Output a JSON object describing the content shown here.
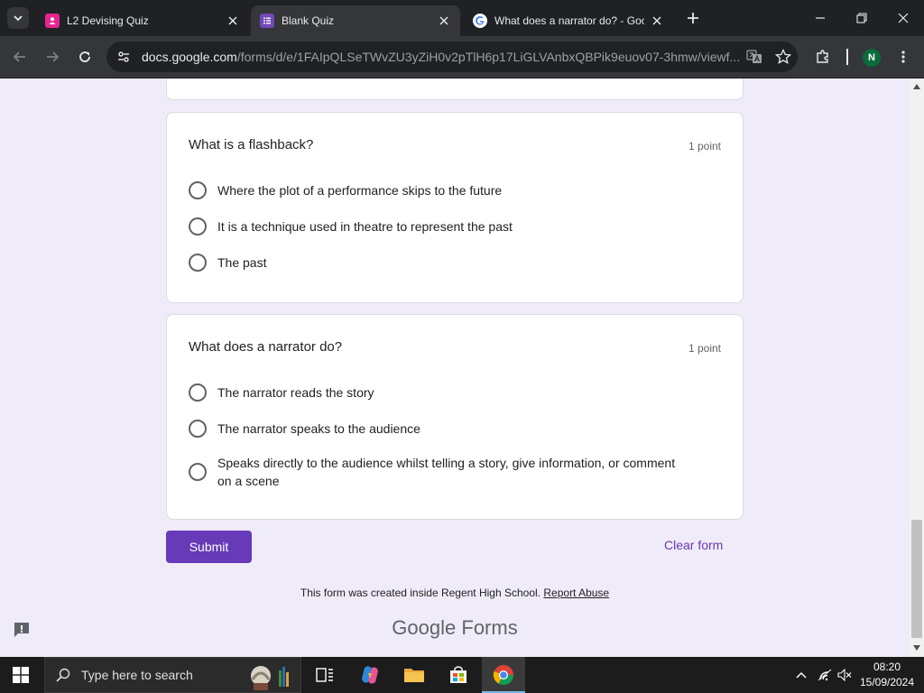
{
  "browser": {
    "tabs": [
      {
        "title": "L2 Devising Quiz",
        "favicon_color": "#e52592"
      },
      {
        "title": "Blank Quiz",
        "favicon_color": "#7248b9"
      },
      {
        "title": "What does a narrator do? - Goo",
        "favicon_color": "#ffffff"
      }
    ],
    "url_host": "docs.google.com",
    "url_path": "/forms/d/e/1FAIpQLSeTWvZU3yZiH0v2pTlH6p17LiGLVAnbxQBPik9euov07-3hmw/viewf...",
    "profile_initial": "N"
  },
  "form": {
    "questions": [
      {
        "title": "What is a flashback?",
        "points": "1 point",
        "options": [
          "Where the plot of a performance skips to the future",
          "It is a technique used in theatre to represent the past",
          "The past"
        ]
      },
      {
        "title": "What does a narrator do?",
        "points": "1 point",
        "options": [
          "The narrator reads the story",
          "The narrator speaks to the audience",
          "Speaks directly to the audience whilst telling a story, give information, or comment on a scene"
        ]
      }
    ],
    "submit_label": "Submit",
    "clear_label": "Clear form",
    "footer_text": "This form was created inside Regent High School.",
    "report_abuse": "Report Abuse",
    "logo_google": "Google",
    "logo_forms": "Forms"
  },
  "taskbar": {
    "search_placeholder": "Type here to search",
    "time": "08:20",
    "date": "15/09/2024"
  },
  "colors": {
    "accent": "#673ab7",
    "page_bg": "#f0ebf8"
  }
}
